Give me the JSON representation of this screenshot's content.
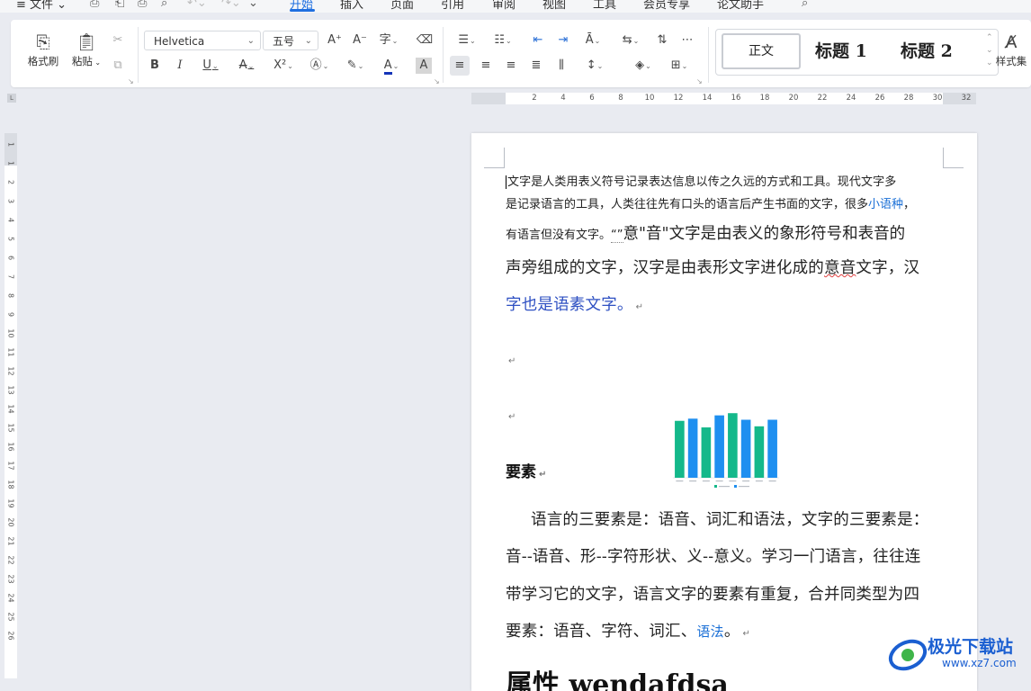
{
  "menu": {
    "file": "≡ 文件 ⌄",
    "tabs": [
      "开始",
      "插入",
      "页面",
      "引用",
      "审阅",
      "视图",
      "工具",
      "会员专享",
      "论文助手"
    ],
    "active_tab": "开始"
  },
  "ribbon": {
    "format_painter": "格式刷",
    "paste": "粘贴",
    "font_name": "Helvetica",
    "font_size": "五号",
    "style_normal": "正文",
    "style_h1": "标题 1",
    "style_h2": "标题 2",
    "style_set": "样式集"
  },
  "ruler": {
    "h_ticks": [
      "2",
      "4",
      "6",
      "8",
      "10",
      "12",
      "14",
      "16",
      "18",
      "20",
      "22",
      "24",
      "26",
      "28",
      "30",
      "32"
    ],
    "v_ticks": [
      "1",
      "1",
      "2",
      "3",
      "4",
      "5",
      "6",
      "7",
      "8",
      "9",
      "10",
      "11",
      "12",
      "13",
      "14",
      "15",
      "16",
      "17",
      "18",
      "19",
      "20",
      "21",
      "22",
      "23",
      "24",
      "25",
      "26"
    ]
  },
  "document": {
    "line1": "文字是人类用表义符号记录表达信息以传之久远的方式和工具。现代文字多",
    "line2a": "是记录语言的工具，人类往往先有口头的语言后产生书面的文字，很多",
    "line2_link": "小语种",
    "line2b": "，",
    "line3a": "有语言但没有文字。",
    "line3_quote": "“”",
    "line3b": "意\"音\"文字是由表义的象形符号和表音的",
    "line4a": "声旁组成的文字，汉字是由表形文字进化成的",
    "line4_squiggle": "意音",
    "line4b": "文字，汉",
    "line5": "字也是语素文字。",
    "heading_yaosu": "要素",
    "para2_line1": "语言的三要素是：语音、词汇和语法，文字的三要素是：",
    "para2_line2": "音--语音、形--字符形状、义--意义。学习一门语言，往往连",
    "para2_line3": "带学习它的文字，语言文字的要素有重复，合并同类型为四",
    "para2_line4a": "要素：语音、字符、词汇、",
    "para2_line4_link": "语法",
    "para2_line4b": "。",
    "heading_big": "属性 wendafdsa",
    "para_mark": "↵"
  },
  "chart_data": {
    "type": "bar",
    "categories": [
      "",
      "",
      "",
      "",
      "",
      "",
      "",
      ""
    ],
    "series": [
      {
        "values": [
          52,
          54,
          46,
          57,
          59,
          53,
          47,
          53
        ],
        "colors": [
          "#14b88a",
          "#1e8ff0",
          "#14b88a",
          "#1e8ff0",
          "#14b88a",
          "#1e8ff0",
          "#14b88a",
          "#1e8ff0"
        ]
      }
    ],
    "legend_colors": [
      "#14b88a",
      "#1e8ff0"
    ],
    "ylim": [
      0,
      60
    ]
  },
  "watermark": {
    "title": "极光下载站",
    "url": "www.xz7.com"
  },
  "colors": {
    "accent": "#1f6fe0",
    "page_bg": "#e9ebf1"
  }
}
